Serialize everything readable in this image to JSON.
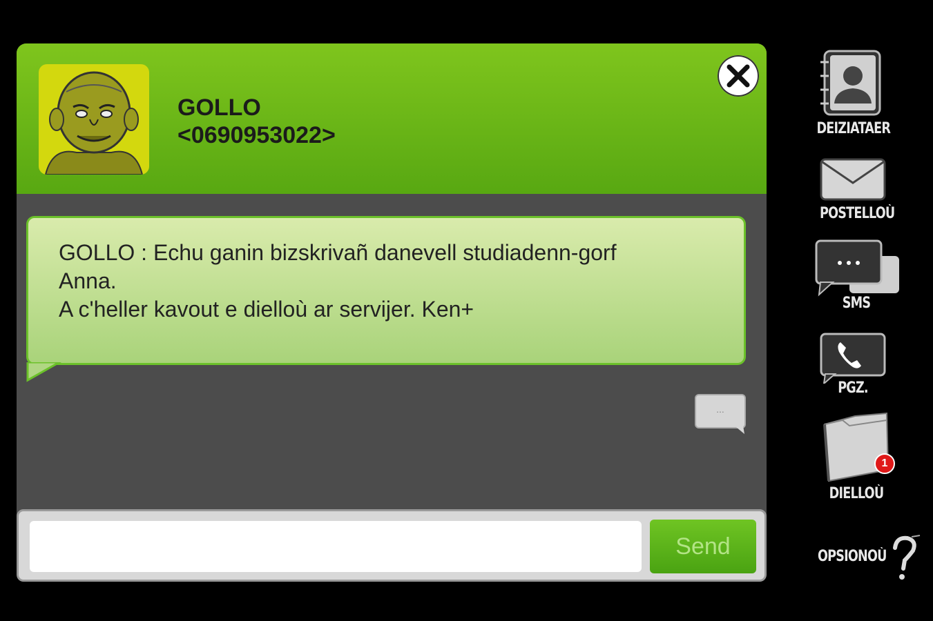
{
  "contact": {
    "name": "GOLLO",
    "number": "<0690953022>"
  },
  "message": {
    "line1": "GOLLO : Echu ganin bizskrivañ danevell studiadenn-gorf",
    "line2": "Anna.",
    "line3": "A c'heller kavout e dielloù ar servijer. Ken+"
  },
  "typing_indicator": "...",
  "compose": {
    "placeholder": "",
    "value": "",
    "send_label": "Send"
  },
  "sidebar": {
    "items": [
      {
        "label": "DEIZIATAER",
        "icon": "contacts-book-icon"
      },
      {
        "label": "POSTELLOÙ",
        "icon": "envelope-icon"
      },
      {
        "label": "SMS",
        "icon": "sms-bubbles-icon"
      },
      {
        "label": "PGZ.",
        "icon": "phone-icon"
      },
      {
        "label": "DIELLOÙ",
        "icon": "folder-icon",
        "badge": "1"
      },
      {
        "label": "OPSIONOÙ",
        "icon": "question-mark-icon"
      }
    ]
  },
  "colors": {
    "header_green": "#6cb818",
    "bubble_border": "#6bc12a",
    "send_green": "#5cb41a",
    "badge_red": "#e01919"
  }
}
